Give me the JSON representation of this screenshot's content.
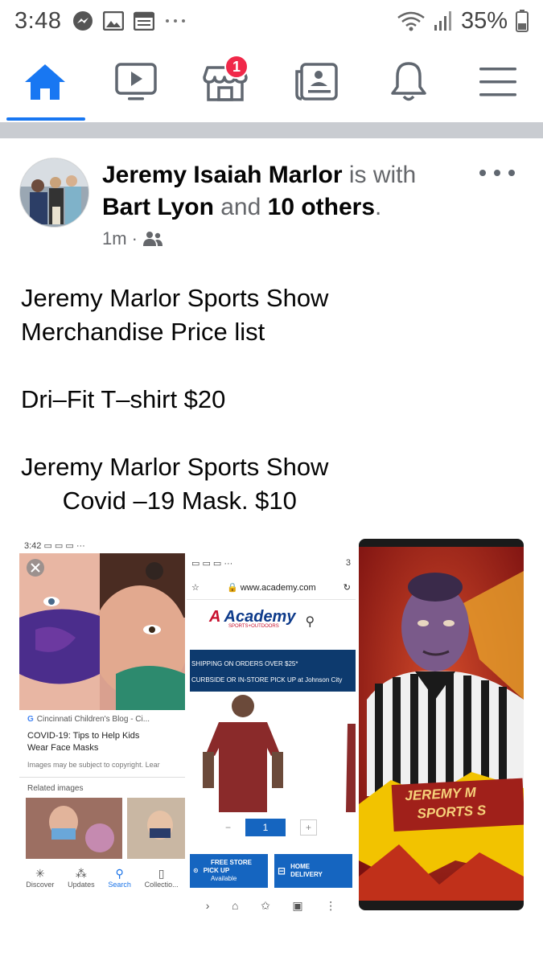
{
  "status_bar": {
    "time": "3:48",
    "battery": "35%",
    "left_icons": [
      "messenger-icon",
      "image-icon",
      "calendar-icon",
      "more-dots-icon"
    ],
    "right_icons": [
      "wifi-icon",
      "signal-icon",
      "battery-icon"
    ]
  },
  "nav": {
    "items": [
      "home-icon",
      "watch-icon",
      "marketplace-icon",
      "news-icon",
      "bell-icon",
      "menu-icon"
    ],
    "marketplace_badge": "1",
    "active_color": "#1877f2"
  },
  "post": {
    "author": "Jeremy Isaiah Marlor",
    "with_text": " is with ",
    "tagged_person": "Bart Lyon",
    "and_text": " and ",
    "others": "10 others",
    "period": ".",
    "time": "1m",
    "body_lines": [
      "Jeremy Marlor Sports Show",
      "Merchandise Price list",
      "",
      "Dri–Fit T–shirt $20",
      "",
      "Jeremy Marlor Sports Show",
      "      Covid –19 Mask. $10"
    ]
  },
  "photo1": {
    "time": "3:42",
    "source": "Cincinnati Children's Blog - Ci...",
    "title_line1": "COVID-19: Tips to Help Kids",
    "title_line2": "Wear Face Masks",
    "copyright": "Images may be subject to copyright. Lear",
    "related": "Related images",
    "tabs": [
      "Discover",
      "Updates",
      "Search",
      "Collectio..."
    ]
  },
  "photo2": {
    "url": "www.academy.com",
    "brand": "Academy",
    "brand_sub": "SPORTS+OUTDOORS",
    "banner1": "SHIPPING ON ORDERS OVER $25*",
    "banner2": "CURBSIDE OR IN-STORE PICK UP at Johnson City",
    "qty": "1",
    "btn1_line1": "FREE STORE",
    "btn1_line2": "PICK UP",
    "btn1_line3": "Available",
    "btn2_line1": "HOME",
    "btn2_line2": "DELIVERY",
    "signal_text": "3"
  },
  "photo3": {
    "line1": "JEREMY M",
    "line2": "SPORTS S"
  }
}
